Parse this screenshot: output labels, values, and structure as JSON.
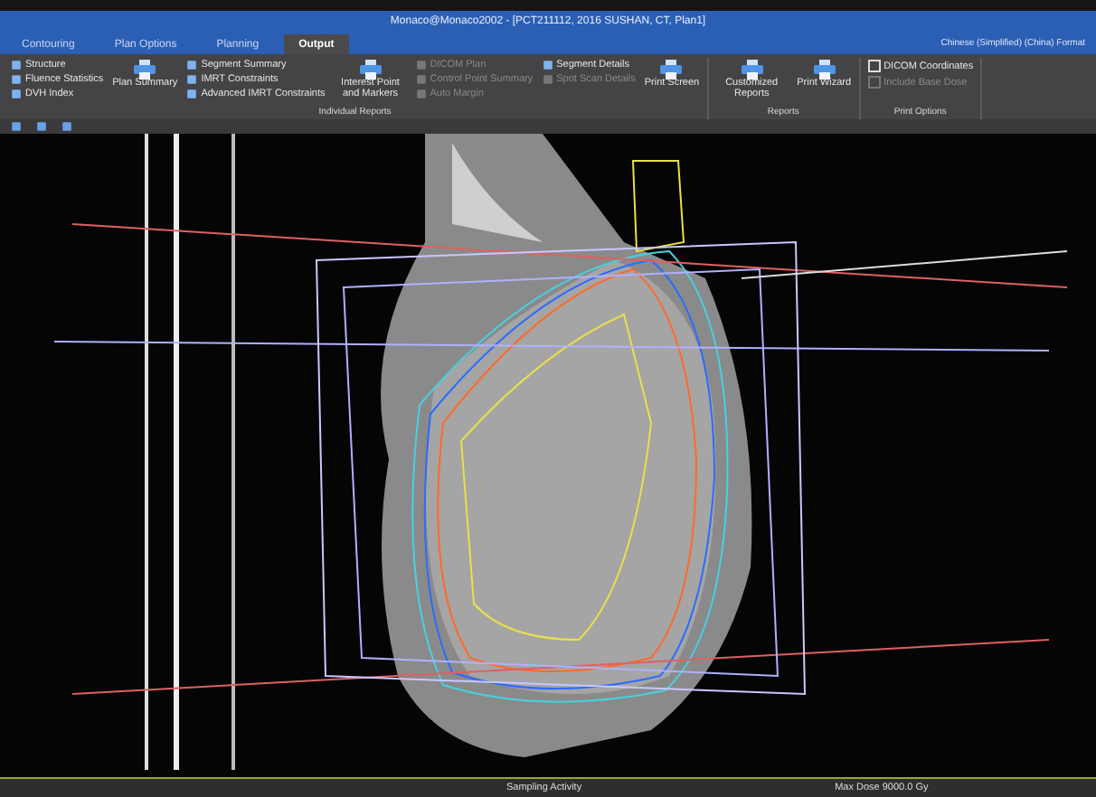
{
  "window": {
    "title": "Monaco@Monaco2002 - [PCT211112, 2016 SUSHAN, CT, Plan1]",
    "locale": "Chinese (Simplified) (China) Format"
  },
  "tabs": [
    {
      "label": "Contouring",
      "selected": false
    },
    {
      "label": "Plan Options",
      "selected": false
    },
    {
      "label": "Planning",
      "selected": false
    },
    {
      "label": "Output",
      "selected": true
    }
  ],
  "ribbon": {
    "groups": [
      {
        "title": "Individual Reports",
        "items": [
          {
            "kind": "small",
            "label": "Structure"
          },
          {
            "kind": "small",
            "label": "Fluence Statistics"
          },
          {
            "kind": "small",
            "label": "DVH Index"
          },
          {
            "kind": "large",
            "label": "Plan Summary"
          },
          {
            "kind": "small",
            "label": "Segment Summary"
          },
          {
            "kind": "small",
            "label": "IMRT Constraints"
          },
          {
            "kind": "small",
            "label": "Advanced IMRT Constraints"
          },
          {
            "kind": "large",
            "label": "Interest Point and Markers"
          },
          {
            "kind": "small",
            "label": "DICOM Plan",
            "disabled": true
          },
          {
            "kind": "small",
            "label": "Control Point Summary",
            "disabled": true
          },
          {
            "kind": "small",
            "label": "Auto Margin",
            "disabled": true
          },
          {
            "kind": "small",
            "label": "Segment Details",
            "disabled": false
          },
          {
            "kind": "small",
            "label": "Spot Scan Details",
            "disabled": true
          },
          {
            "kind": "large",
            "label": "Print Screen"
          }
        ]
      },
      {
        "title": "Reports",
        "items": [
          {
            "kind": "large",
            "label": "Customized Reports"
          },
          {
            "kind": "large",
            "label": "Print Wizard"
          }
        ]
      },
      {
        "title": "Print Options",
        "items": [
          {
            "kind": "check",
            "label": "DICOM Coordinates",
            "checked": false,
            "disabled": false
          },
          {
            "kind": "check",
            "label": "Include Base Dose",
            "checked": false,
            "disabled": true
          }
        ]
      }
    ]
  },
  "status_bar": [
    "Sampling Activity",
    "Max Dose 9000.0 Gy"
  ]
}
